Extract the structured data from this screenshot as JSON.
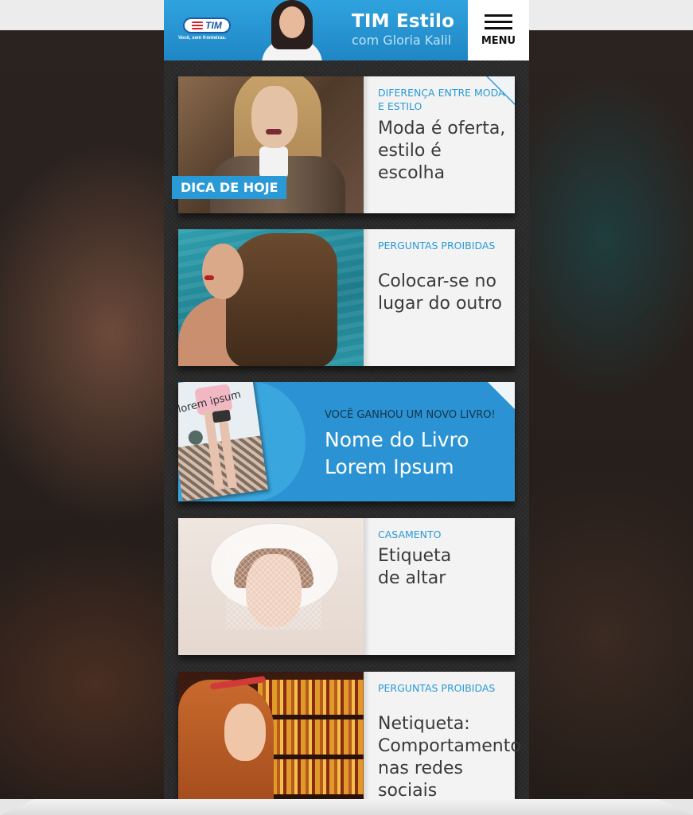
{
  "header": {
    "logo_text": "TIM",
    "logo_tagline": "Você, sem fronteiras.",
    "title": "TIM Estilo",
    "subtitle": "com Gloria Kalil",
    "menu_label": "MENU",
    "colors": {
      "brand_blue": "#2a9ad6",
      "dark_text": "#3a3a3a"
    }
  },
  "cards": [
    {
      "badge": "DICA DE HOJE",
      "category": "DIFERENÇA ENTRE MODA E ESTILO",
      "headline": "Moda é oferta, estilo é escolha"
    },
    {
      "category": "PERGUNTAS PROIBIDAS",
      "headline": "Colocar-se no lugar do outro"
    },
    {
      "category": "CASAMENTO",
      "headline": "Etiqueta de altar"
    },
    {
      "category": "PERGUNTAS PROIBIDAS",
      "headline": "Netiqueta: Comportamento nas redes sociais"
    }
  ],
  "book": {
    "cover_title": "lorem ipsum",
    "kicker": "VOCÊ GANHOU UM NOVO LIVRO!",
    "title": "Nome do Livro Lorem Ipsum"
  },
  "icons": [
    "hamburger-menu-icon",
    "tim-logo",
    "folded-corner-icon"
  ]
}
